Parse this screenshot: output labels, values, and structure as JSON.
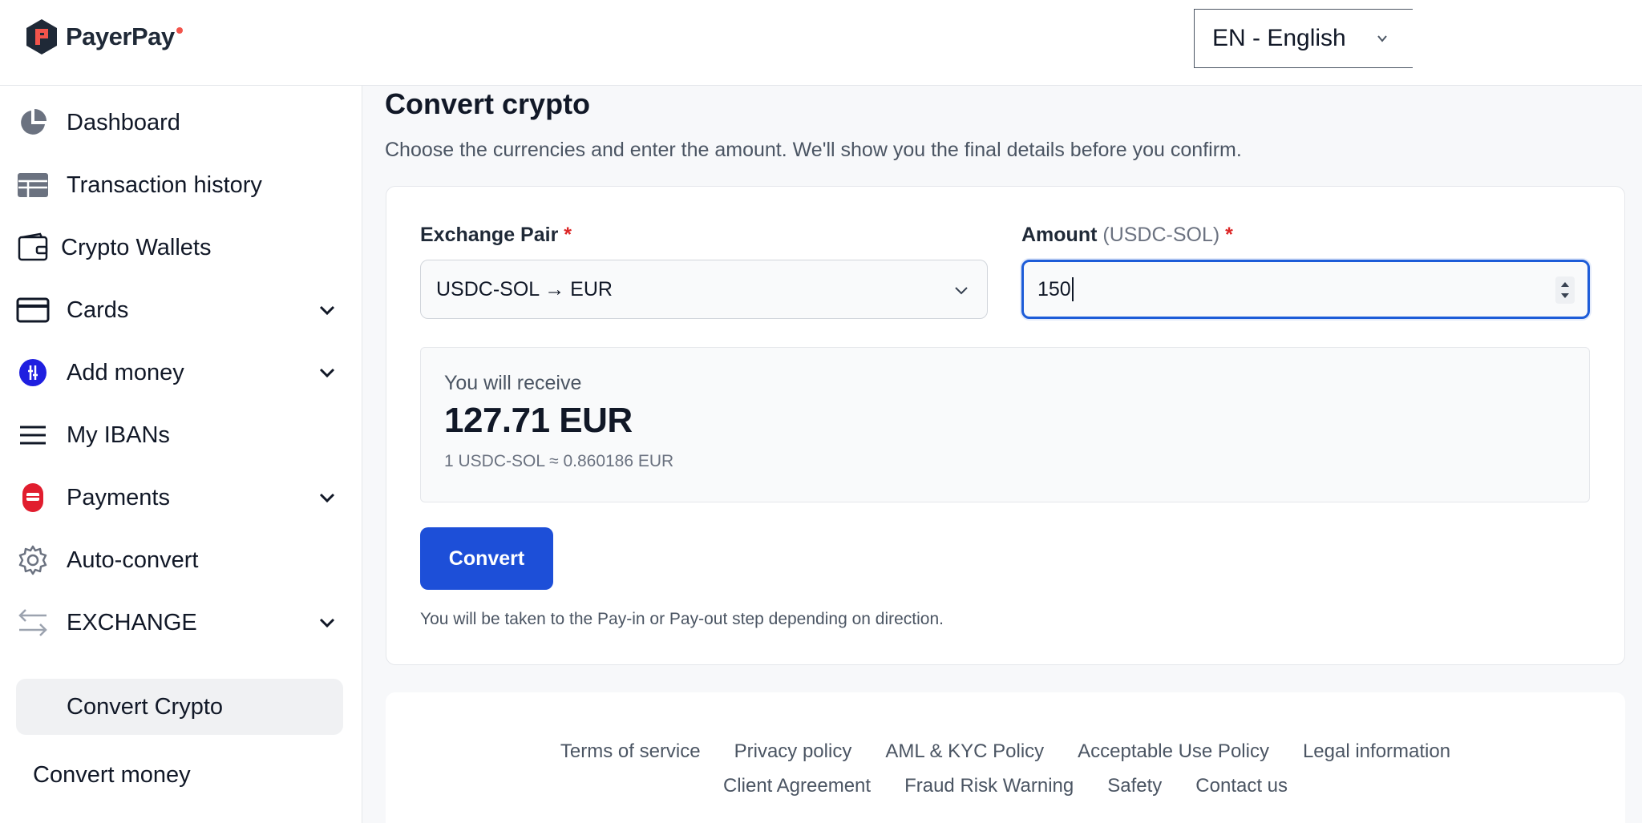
{
  "brand": {
    "name": "PayerPay",
    "accent": "#f2544b",
    "logo_color": "#1f2937"
  },
  "language": {
    "selected": "EN - English",
    "icon": "chevron-down-icon"
  },
  "sidebar": {
    "items": [
      {
        "label": "Dashboard",
        "icon": "pie-chart-icon"
      },
      {
        "label": "Transaction history",
        "icon": "table-icon"
      },
      {
        "label": "Crypto Wallets",
        "icon": "wallet-icon"
      },
      {
        "label": "Cards",
        "icon": "credit-card-icon",
        "expandable": true
      },
      {
        "label": "Add money",
        "icon": "add-money-icon",
        "expandable": true
      },
      {
        "label": "My IBANs",
        "icon": "menu-lines-icon"
      },
      {
        "label": "Payments",
        "icon": "payments-icon",
        "expandable": true
      },
      {
        "label": "Auto-convert",
        "icon": "gear-icon"
      },
      {
        "label": "EXCHANGE",
        "icon": "exchange-arrows-icon",
        "expandable": true
      }
    ],
    "sub_items": [
      {
        "label": "Convert Crypto",
        "active": true
      },
      {
        "label": "Convert money",
        "active": false
      }
    ]
  },
  "page": {
    "title": "Convert crypto",
    "subtitle": "Choose the currencies and enter the amount. We'll show you the final details before you confirm."
  },
  "form": {
    "pair_label": "Exchange Pair",
    "pair_required": "*",
    "pair_value": "USDC-SOL → EUR",
    "amount_label": "Amount",
    "amount_unit": "(USDC-SOL)",
    "amount_required": "*",
    "amount_value": "150",
    "focus_color": "#1d5cd8"
  },
  "receive": {
    "label": "You will receive",
    "amount": "127.71 EUR",
    "rate": "1 USDC-SOL ≈ 0.860186 EUR"
  },
  "actions": {
    "convert_label": "Convert",
    "button_color": "#1d4fd8",
    "hint": "You will be taken to the Pay-in or Pay-out step depending on direction."
  },
  "footer": {
    "row1": [
      "Terms of service",
      "Privacy policy",
      "AML & KYC Policy",
      "Acceptable Use Policy",
      "Legal information"
    ],
    "row2": [
      "Client Agreement",
      "Fraud Risk Warning",
      "Safety",
      "Contact us"
    ]
  }
}
